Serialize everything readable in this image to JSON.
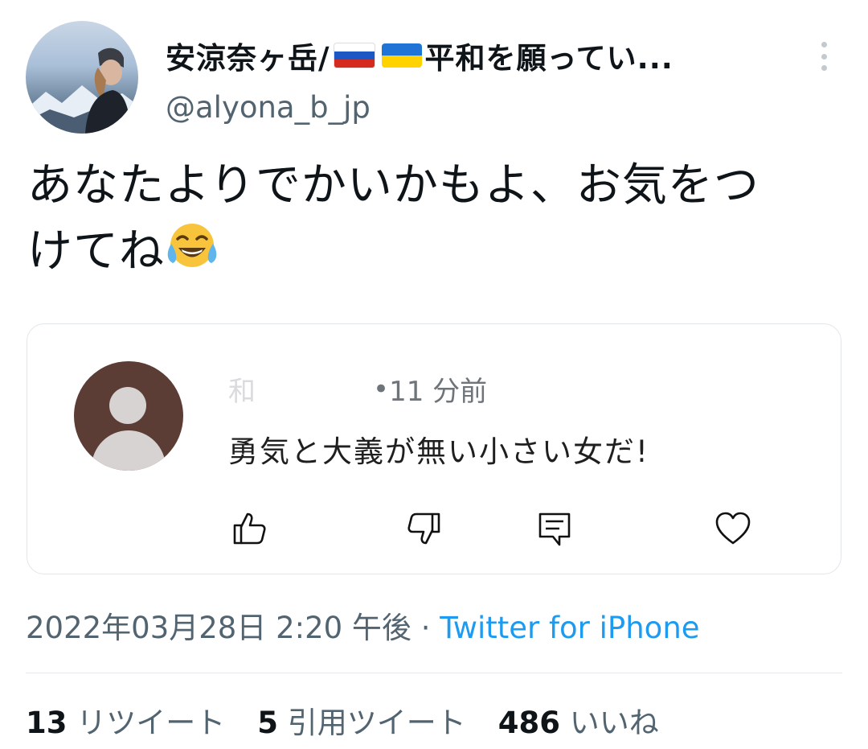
{
  "tweet": {
    "author": {
      "display_name_prefix": "安涼奈ヶ岳/ ",
      "display_name_suffix": "平和を願ってい...",
      "flags": [
        "russia-flag",
        "ukraine-flag"
      ],
      "handle": "@alyona_b_jp"
    },
    "text_line1": "あなたよりでかいかもよ、お気をつ",
    "text_line2": "けてね",
    "emoji": "face-with-tears-of-joy",
    "embedded_comment": {
      "author_name": "和　　　　　　",
      "separator": " • ",
      "time_ago": "11 分前",
      "text": "勇気と大義が無い小さい女だ!",
      "actions": [
        "thumbs-up-icon",
        "thumbs-down-icon",
        "comment-icon",
        "heart-icon"
      ]
    },
    "timestamp": "2022年03月28日 2:20 午後",
    "timestamp_separator": " · ",
    "source": "Twitter for iPhone",
    "stats": {
      "retweets_count": "13",
      "retweets_label": " リツイート",
      "quotes_count": "5",
      "quotes_label": " 引用ツイート",
      "likes_count": "486",
      "likes_label": " いいね"
    }
  },
  "colors": {
    "text": "#0f1419",
    "secondary_text": "#536471",
    "link": "#1d9bf0",
    "card_border": "#e2e6ea",
    "card_avatar_bg": "#5b3d35"
  }
}
